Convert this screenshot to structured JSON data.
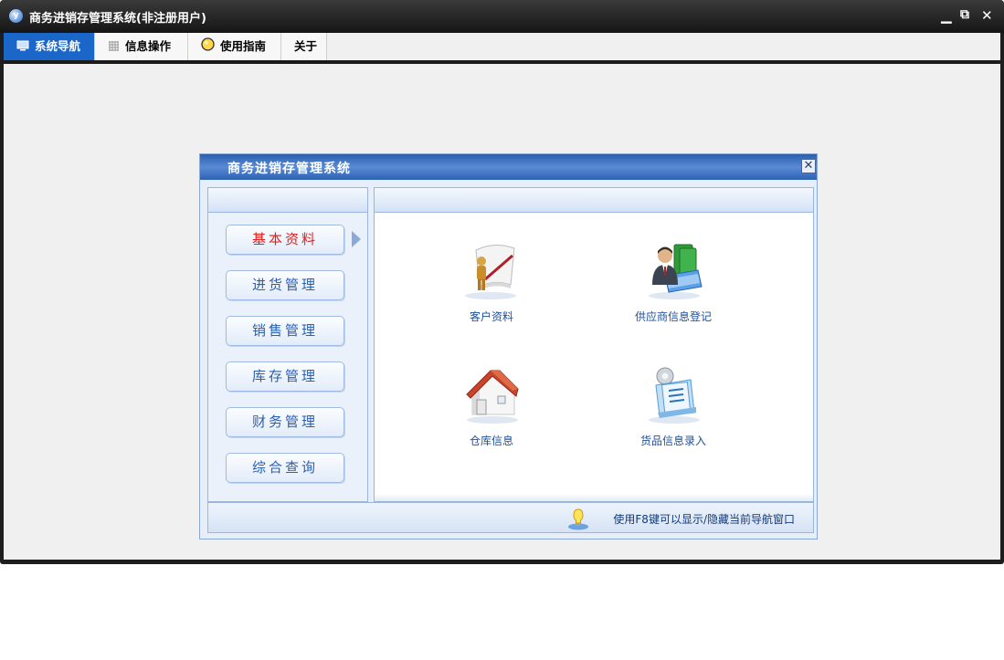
{
  "window": {
    "title": "商务进销存管理系统(非注册用户)",
    "app_icon": "y",
    "controls": {
      "minimize": "▁",
      "restore": "⧉",
      "close": "✕"
    }
  },
  "tabs": [
    {
      "label": "系统导航",
      "icon": "monitor-icon",
      "active": true
    },
    {
      "label": "信息操作",
      "icon": "grid-icon",
      "active": false
    },
    {
      "label": "使用指南",
      "icon": "lightbulb-icon",
      "active": false
    },
    {
      "label": "关于",
      "icon": "",
      "active": false
    }
  ],
  "dialog": {
    "title": "商务进销存管理系统",
    "close_glyph": "✕",
    "nav_buttons": [
      {
        "label": "基本资料",
        "active": true
      },
      {
        "label": "进货管理",
        "active": false
      },
      {
        "label": "销售管理",
        "active": false
      },
      {
        "label": "库存管理",
        "active": false
      },
      {
        "label": "财务管理",
        "active": false
      },
      {
        "label": "综合查询",
        "active": false
      }
    ],
    "items": [
      {
        "label": "客户资料",
        "icon": "customer-figure-icon"
      },
      {
        "label": "供应商信息登记",
        "icon": "supplier-person-book-icon"
      },
      {
        "label": "仓库信息",
        "icon": "warehouse-house-icon"
      },
      {
        "label": "货品信息录入",
        "icon": "goods-checklist-icon"
      }
    ],
    "hint": "使用F8键可以显示/隐藏当前导航窗口"
  },
  "colors": {
    "active_tab": "#1b66c9",
    "dialog_title": "#2c62b5",
    "active_nav_text": "#e22020",
    "nav_text": "#2a5fb5"
  }
}
